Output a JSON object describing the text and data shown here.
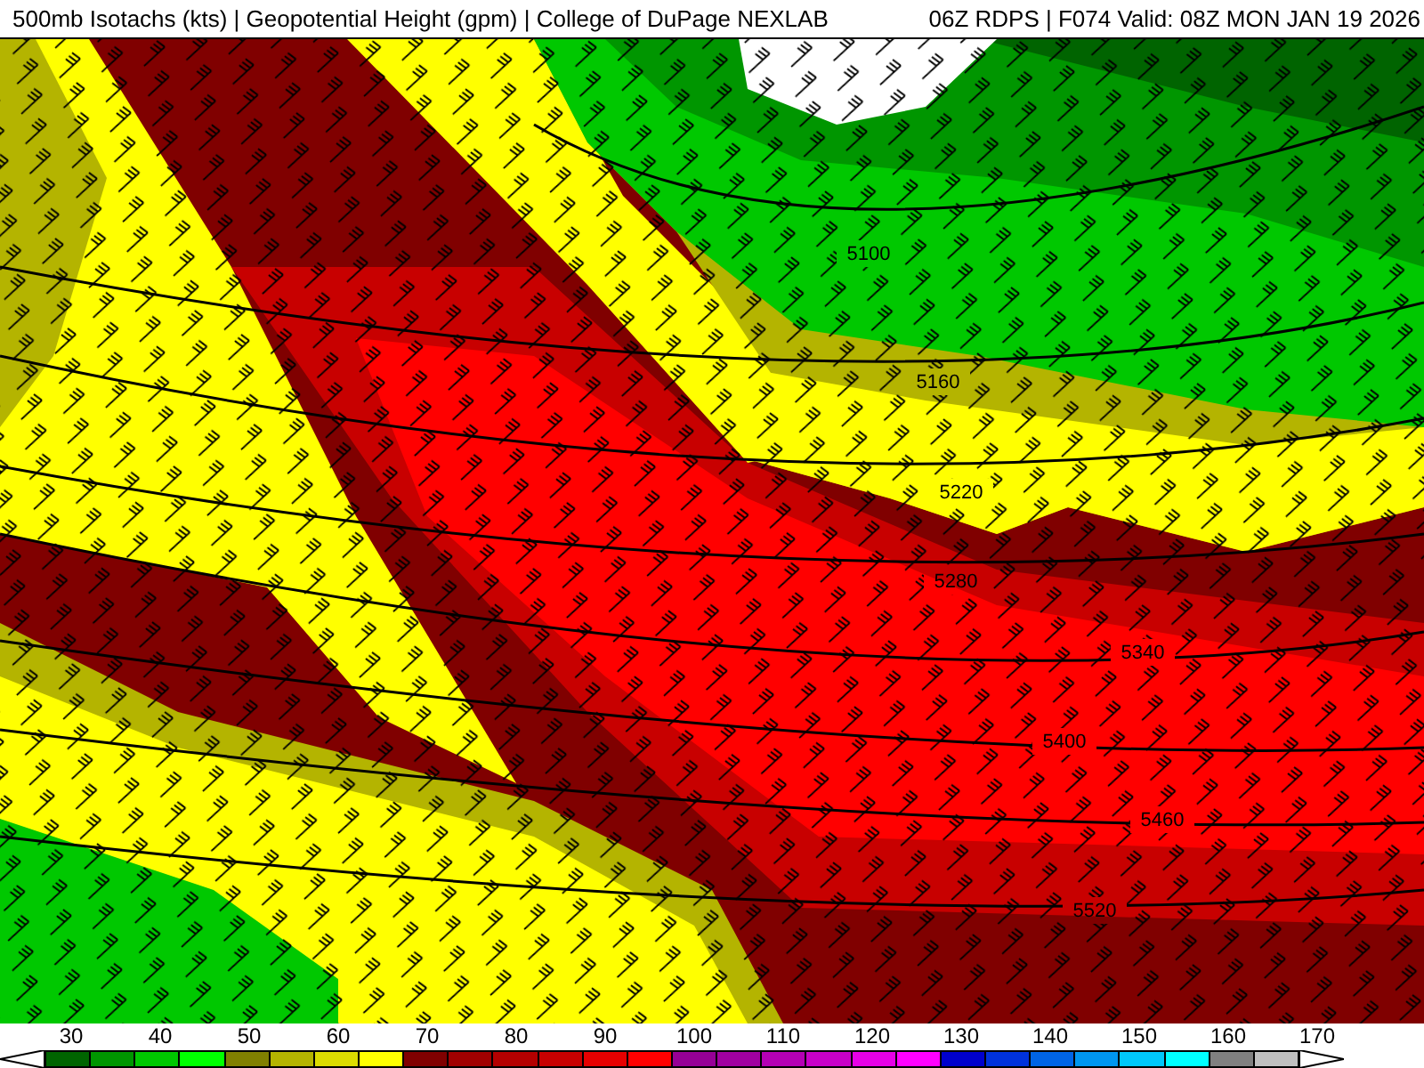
{
  "header": {
    "title": "500mb Isotachs (kts) | Geopotential Height (gpm) | College of DuPage NEXLAB",
    "run_info": "06Z RDPS | F074 Valid: 08Z MON JAN 19 2026"
  },
  "map": {
    "contour_labels": [
      "5100",
      "5160",
      "5220",
      "5280",
      "5340",
      "5400",
      "5460",
      "5520"
    ]
  },
  "legend": {
    "tick_labels": [
      "30",
      "40",
      "50",
      "60",
      "70",
      "80",
      "90",
      "100",
      "110",
      "120",
      "130",
      "140",
      "150",
      "160",
      "170"
    ],
    "swatches": [
      {
        "color": "#006400"
      },
      {
        "color": "#009600"
      },
      {
        "color": "#00c800"
      },
      {
        "color": "#00ff00"
      },
      {
        "color": "#808000"
      },
      {
        "color": "#b4b400"
      },
      {
        "color": "#dcdc00"
      },
      {
        "color": "#ffff00"
      },
      {
        "color": "#800000"
      },
      {
        "color": "#a00000"
      },
      {
        "color": "#b40000"
      },
      {
        "color": "#c80000"
      },
      {
        "color": "#e60000"
      },
      {
        "color": "#ff0000"
      },
      {
        "color": "#960096"
      },
      {
        "color": "#a000a0"
      },
      {
        "color": "#b400b4"
      },
      {
        "color": "#c800c8"
      },
      {
        "color": "#e600e6"
      },
      {
        "color": "#ff00ff"
      },
      {
        "color": "#0000cd"
      },
      {
        "color": "#0032dc"
      },
      {
        "color": "#0064e6"
      },
      {
        "color": "#0096f0"
      },
      {
        "color": "#00c8fa"
      },
      {
        "color": "#00ffff"
      },
      {
        "color": "#808080"
      },
      {
        "color": "#c0c0c0"
      }
    ]
  }
}
